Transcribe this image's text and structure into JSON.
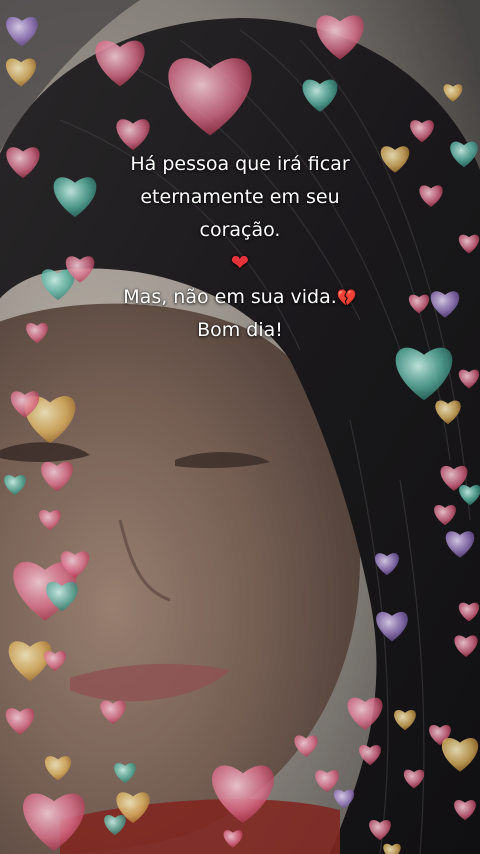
{
  "message": {
    "line1": "Há pessoa que irá  ficar",
    "line2": "eternamente em seu",
    "line3": "coração.",
    "line4": "Mas, não em sua vida.",
    "line5": "Bom dia!"
  },
  "icons": {
    "heart": "red-heart-icon",
    "broken_heart": "broken-heart-icon"
  },
  "colors": {
    "text": "#ffffff",
    "heart_red": "#e8323c",
    "hearts_pink": "#f07a9a",
    "hearts_teal": "#5fc3b0",
    "hearts_gold": "#f2c46a",
    "hair": "#1c1a1c"
  }
}
